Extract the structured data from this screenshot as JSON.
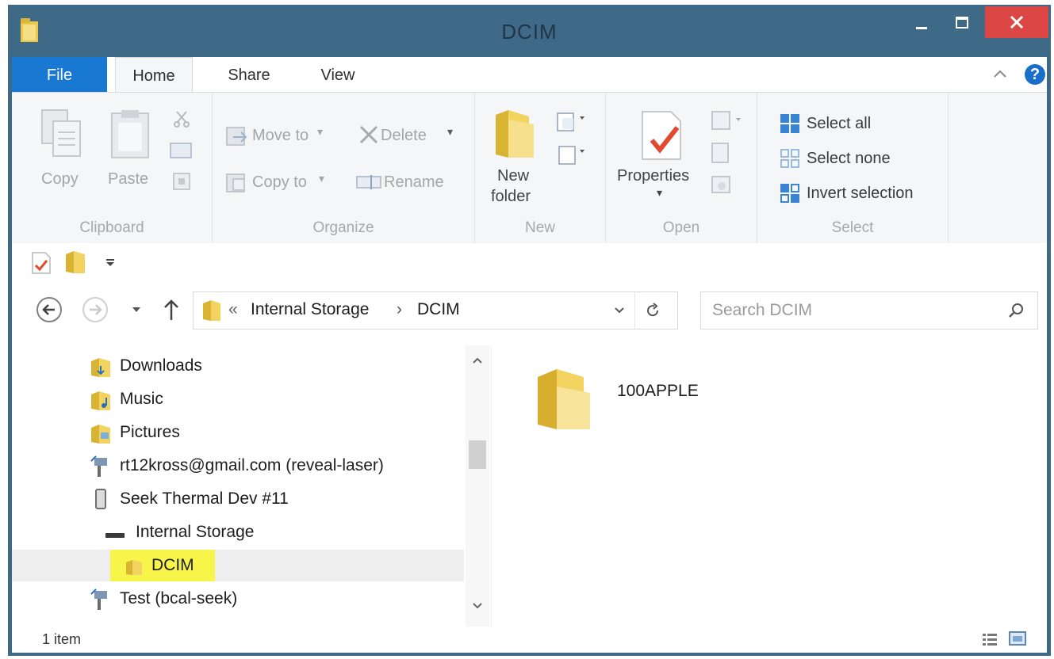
{
  "window": {
    "title": "DCIM"
  },
  "tabs": {
    "file": "File",
    "home": "Home",
    "share": "Share",
    "view": "View"
  },
  "ribbon": {
    "clipboard": {
      "copy": "Copy",
      "paste": "Paste",
      "label": "Clipboard"
    },
    "organize": {
      "move_to": "Move to",
      "copy_to": "Copy to",
      "delete": "Delete",
      "rename": "Rename",
      "label": "Organize"
    },
    "new": {
      "new_folder_line1": "New",
      "new_folder_line2": "folder",
      "label": "New"
    },
    "open": {
      "properties": "Properties",
      "label": "Open"
    },
    "select": {
      "select_all": "Select all",
      "select_none": "Select none",
      "invert": "Invert selection",
      "label": "Select"
    }
  },
  "address": {
    "overflow": "«",
    "crumbs": [
      "Internal Storage",
      "DCIM"
    ],
    "separator": "›"
  },
  "search": {
    "placeholder": "Search DCIM"
  },
  "nav_tree": [
    {
      "label": "Downloads"
    },
    {
      "label": "Music"
    },
    {
      "label": "Pictures"
    },
    {
      "label": "rt12kross@gmail.com (reveal-laser)"
    },
    {
      "label": "Seek Thermal Dev #11"
    },
    {
      "label": "Internal Storage"
    },
    {
      "label": "DCIM"
    },
    {
      "label": "Test (bcal-seek)"
    }
  ],
  "files": [
    {
      "name": "100APPLE"
    }
  ],
  "status": {
    "item_count": "1 item"
  },
  "colors": {
    "titlebar": "#3f6a87",
    "file_tab": "#1978d2",
    "close": "#dc4644",
    "highlight": "#f8f54a"
  }
}
